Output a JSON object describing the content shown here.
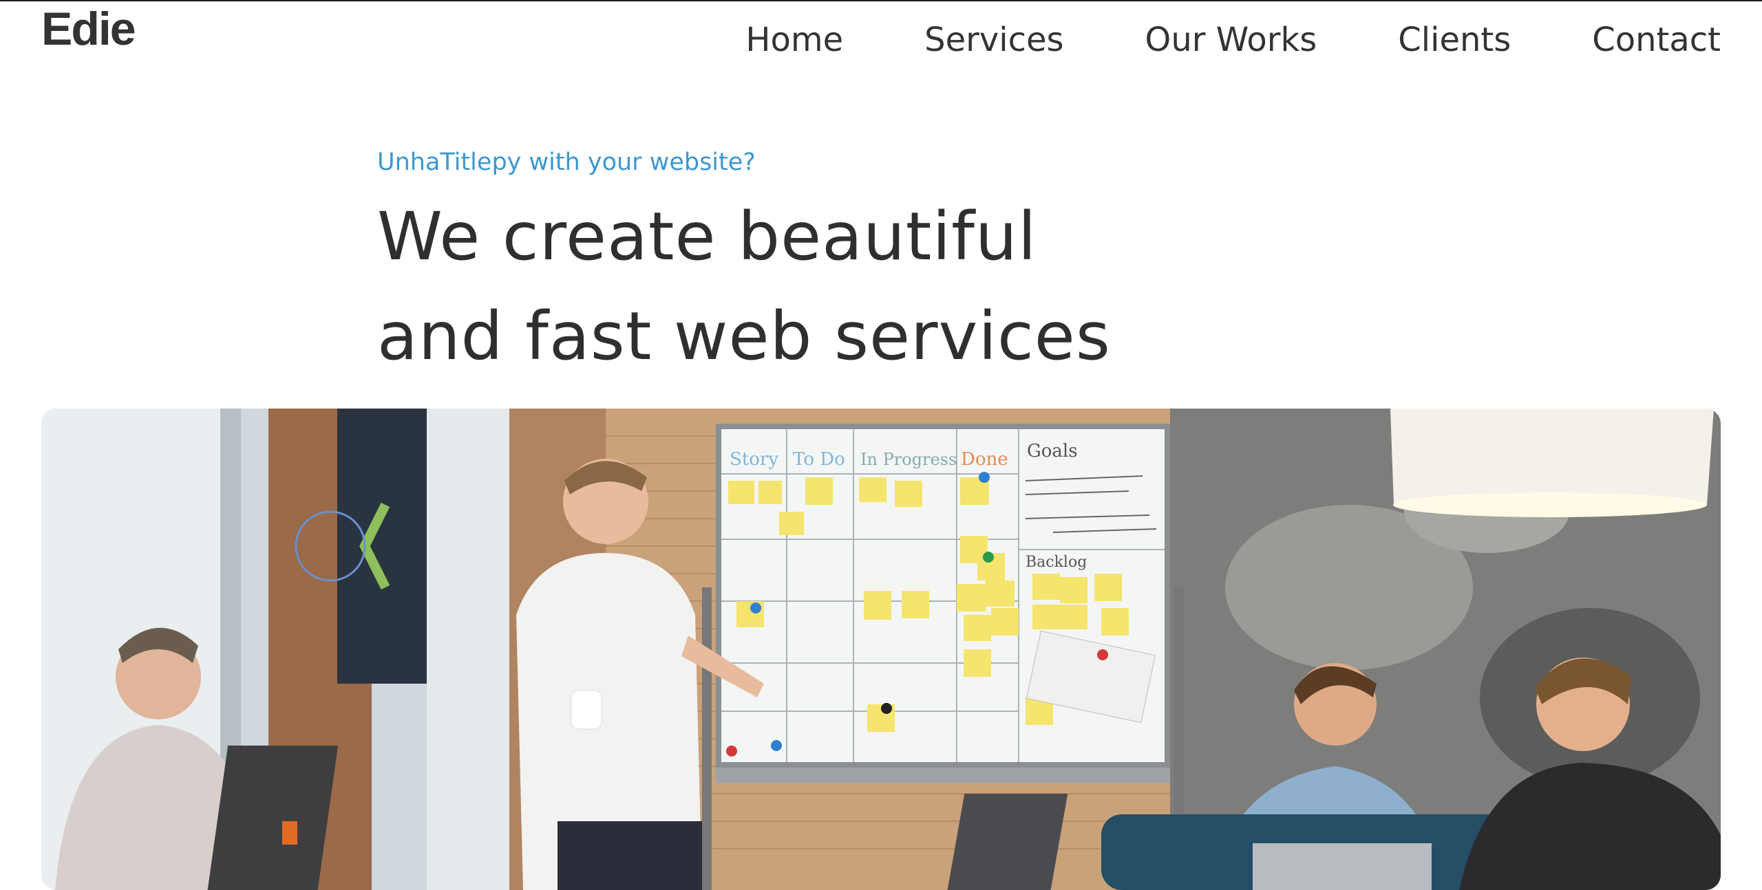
{
  "brand": {
    "logo_text": "Edie"
  },
  "nav": {
    "items": [
      {
        "label": "Home"
      },
      {
        "label": "Services"
      },
      {
        "label": "Our Works"
      },
      {
        "label": "Clients"
      },
      {
        "label": "Contact"
      }
    ]
  },
  "hero": {
    "eyebrow": "UnhaTitlepy with your website?",
    "headline_line1": "We create beautiful",
    "headline_line2": "and fast web services"
  },
  "photo": {
    "whiteboard_headers": [
      "Story",
      "To Do",
      "In Progress",
      "Done",
      "Goals"
    ],
    "whiteboard_backlog": "Backlog"
  },
  "colors": {
    "accent": "#3d97cf",
    "text": "#2f2f2f"
  }
}
